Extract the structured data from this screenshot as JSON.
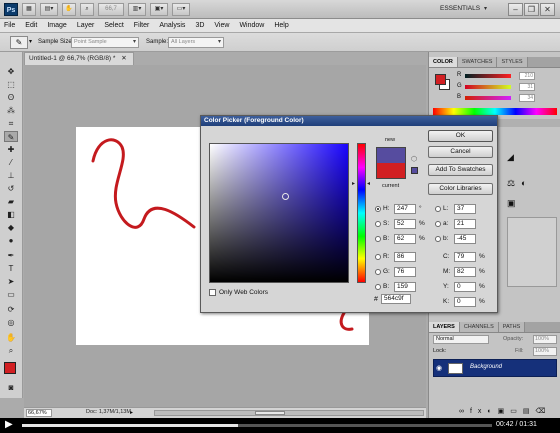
{
  "app": {
    "logo": "Ps",
    "zoom_level": "66,7",
    "workspace": "ESSENTIALS",
    "window_controls": {
      "minimize": "–",
      "restore": "❐",
      "close": "✕"
    }
  },
  "menu": [
    "File",
    "Edit",
    "Image",
    "Layer",
    "Select",
    "Filter",
    "Analysis",
    "3D",
    "View",
    "Window",
    "Help"
  ],
  "options": {
    "sample_size_label": "Sample Size:",
    "sample_size_value": "Point Sample",
    "sample_label": "Sample:",
    "sample_value": "All Layers"
  },
  "document": {
    "tab_title": "Untitled-1 @ 66,7% (RGB/8) *",
    "zoom": "66,67%",
    "doc_info": "Doc: 1,37M/1,13M"
  },
  "panels": {
    "color_tabs": [
      "COLOR",
      "SWATCHES",
      "STYLES"
    ],
    "color_channels": [
      {
        "label": "R",
        "value": "210"
      },
      {
        "label": "G",
        "value": "31"
      },
      {
        "label": "B",
        "value": "34"
      }
    ],
    "layers_tabs": [
      "LAYERS",
      "CHANNELS",
      "PATHS"
    ],
    "blend_mode": "Normal",
    "opacity_label": "Opacity:",
    "opacity_value": "100%",
    "lock_label": "Lock:",
    "fill_label": "Fill:",
    "fill_value": "100%",
    "layer_name": "Background"
  },
  "dialog": {
    "title": "Color Picker (Foreground Color)",
    "new_label": "new",
    "current_label": "current",
    "buttons": {
      "ok": "OK",
      "cancel": "Cancel",
      "add_swatches": "Add To Swatches",
      "libraries": "Color Libraries"
    },
    "hsb": [
      {
        "label": "H:",
        "value": "247",
        "unit": "°"
      },
      {
        "label": "S:",
        "value": "52",
        "unit": "%"
      },
      {
        "label": "B:",
        "value": "62",
        "unit": "%"
      }
    ],
    "rgb": [
      {
        "label": "R:",
        "value": "86"
      },
      {
        "label": "G:",
        "value": "76"
      },
      {
        "label": "B:",
        "value": "159"
      }
    ],
    "lab": [
      {
        "label": "L:",
        "value": "37"
      },
      {
        "label": "a:",
        "value": "21"
      },
      {
        "label": "b:",
        "value": "-45"
      }
    ],
    "cmyk": [
      {
        "label": "C:",
        "value": "79",
        "unit": "%"
      },
      {
        "label": "M:",
        "value": "82",
        "unit": "%"
      },
      {
        "label": "Y:",
        "value": "0",
        "unit": "%"
      },
      {
        "label": "K:",
        "value": "0",
        "unit": "%"
      }
    ],
    "web_colors_label": "Only Web Colors",
    "hex_label": "#",
    "hex_value": "564c9f",
    "new_color": "#564c9f",
    "current_color": "#d21f22"
  },
  "player": {
    "time": "00:42 / 01:31",
    "progress_fraction": 0.46
  }
}
